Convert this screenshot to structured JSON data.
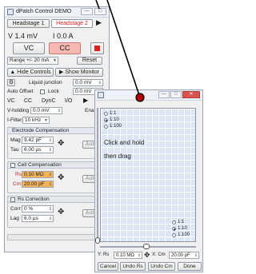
{
  "main_window": {
    "title": "dPatch Control DEMO",
    "tabs": [
      "Headstage 1",
      "Headstage 2"
    ],
    "readout_voltage": "V 1.4 mV",
    "readout_current": "I 0.0 A",
    "mode_vc": "VC",
    "mode_cc": "CC",
    "range_select": "Range +/- 20 mA",
    "reset_label": "Reset",
    "hide_controls": "Hide Controls",
    "show_monitor": "Show Monitor",
    "liquid_junction_label": "Liquid junction",
    "liquid_junction_value": "0.0 mV",
    "auto_offset_label": "Auto Offset",
    "lock_label": "Lock",
    "offset_value": "0.0 mV",
    "sub_tabs": [
      "VC",
      "CC",
      "DynC",
      "I/O"
    ],
    "vholding_label": "V-holding",
    "vholding_value": "0.0 mV",
    "enable_label": "Enable",
    "ifilter_label": "I-Filter",
    "ifilter_value": "10 kHz",
    "electrode": {
      "title": "Electrode Compensation",
      "mag_label": "Mag",
      "mag_value": "9.42 pF",
      "tau_label": "Tau",
      "tau_value": "6.00 µs",
      "auto_label": "Auto"
    },
    "cell": {
      "title": "Cell Compensation",
      "rs_label": "Rs",
      "rs_value": "0.10 MΩ",
      "cm_label": "Cm",
      "cm_value": "20.00 pF",
      "auto_label": "Auto"
    },
    "rs_corr": {
      "title": "Rs Correction",
      "corr_label": "Corr",
      "corr_value": "0 %",
      "lag_label": "Lag",
      "lag_value": "6.0 µs",
      "auto_label": "Auto"
    }
  },
  "popup": {
    "radio_top": [
      "1:1",
      "1:10",
      "1:100"
    ],
    "radio_top_selected": "1:10",
    "radio_bottom": [
      "1:1",
      "1:10",
      "1:100"
    ],
    "radio_bottom_selected": "1:10",
    "instruction_line1": "Click and hold",
    "instruction_line2": "then drag",
    "rs_label": "Y: Rs",
    "rs_value": "0.10 MΩ",
    "cm_label": "X: Cm",
    "cm_value": "20.00 pF",
    "buttons": [
      "Cancel",
      "Undo Rs",
      "Undo Cm",
      "Done"
    ]
  },
  "colors": {
    "record_red": "#e0201b",
    "mode_cc_bg": "#f5b8b3",
    "grid_blue": "#dbe6f5",
    "rs_highlight": "#f2b35a",
    "tab_active_red": "#cc1f1f"
  }
}
